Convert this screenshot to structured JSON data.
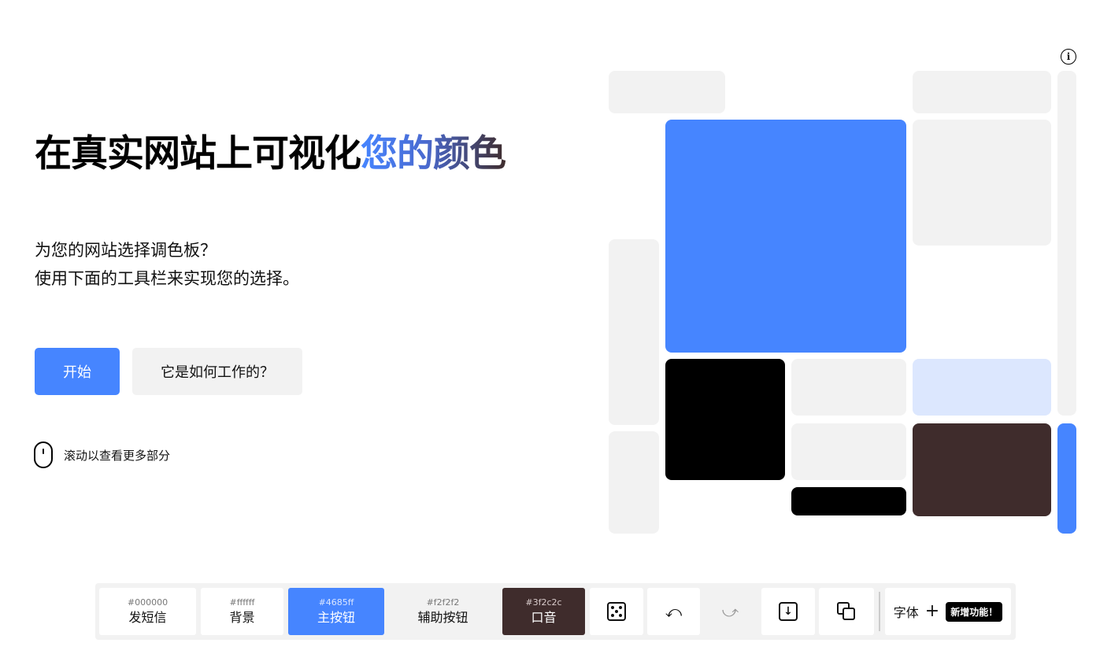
{
  "hero": {
    "title_main": "在真实网站上可视化",
    "title_accent": "您的颜色",
    "subtitle_line1": "为您的网站选择调色板？",
    "subtitle_line2": "使用下面的工具栏来实现您的选择。"
  },
  "buttons": {
    "start": "开始",
    "how_it_works": "它是如何工作的？"
  },
  "scroll_hint": "滚动以查看更多部分",
  "info_icon": "i",
  "toolbar": {
    "colors": [
      {
        "hex": "#000000",
        "label": "发短信"
      },
      {
        "hex": "#ffffff",
        "label": "背景"
      },
      {
        "hex": "#4685ff",
        "label": "主按钮"
      },
      {
        "hex": "#f2f2f2",
        "label": "辅助按钮"
      },
      {
        "hex": "#3f2c2c",
        "label": "口音"
      }
    ],
    "undo_glyph": "⤺",
    "redo_glyph": "⤻",
    "download_glyph": "↓",
    "font_label": "字体",
    "plus_glyph": "+",
    "new_badge": "新增功能！"
  },
  "palette": {
    "text": "#000000",
    "background": "#ffffff",
    "primary": "#4685ff",
    "secondary": "#f2f2f2",
    "accent": "#3f2c2c",
    "primary_light": "#dce7fe"
  }
}
